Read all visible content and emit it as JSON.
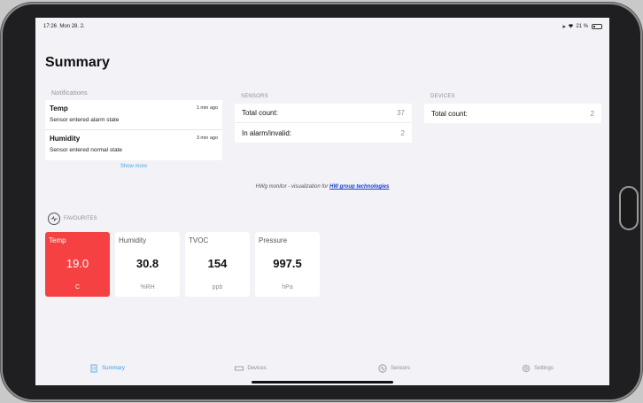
{
  "status": {
    "time": "17:26",
    "date": "Mon 28. 2.",
    "battery": "21 %"
  },
  "page": {
    "title": "Summary"
  },
  "notifications": {
    "label": "Notifications",
    "items": [
      {
        "name": "Temp",
        "message": "Sensor entered alarm state",
        "time": "1 min ago"
      },
      {
        "name": "Humidity",
        "message": "Sensor entered normal state",
        "time": "3 min ago"
      }
    ],
    "show_more": "Show more"
  },
  "sensors": {
    "label": "SENSORS",
    "rows": [
      {
        "label": "Total count:",
        "value": "37"
      },
      {
        "label": "In alarm/invalid:",
        "value": "2"
      }
    ]
  },
  "devices": {
    "label": "DEVICES",
    "rows": [
      {
        "label": "Total count:",
        "value": "2"
      }
    ]
  },
  "credit": {
    "text": "HWg monitor - visualization for ",
    "link": "HW group technologies"
  },
  "favourites": {
    "label": "FAVOURITES",
    "tiles": [
      {
        "name": "Temp",
        "value": "19.0",
        "unit": "C",
        "alarm": true
      },
      {
        "name": "Humidity",
        "value": "30.8",
        "unit": "%RH",
        "alarm": false
      },
      {
        "name": "TVOC",
        "value": "154",
        "unit": "ppb",
        "alarm": false
      },
      {
        "name": "Pressure",
        "value": "997.5",
        "unit": "hPa",
        "alarm": false
      }
    ]
  },
  "tabs": [
    {
      "label": "Summary",
      "icon": "summary-icon",
      "active": true
    },
    {
      "label": "Devices",
      "icon": "devices-icon",
      "active": false
    },
    {
      "label": "Sensors",
      "icon": "sensors-icon",
      "active": false
    },
    {
      "label": "Settings",
      "icon": "settings-icon",
      "active": false
    }
  ],
  "colors": {
    "accent": "#3a9ce3",
    "alarm": "#f54142",
    "background": "#f2f2f7"
  }
}
